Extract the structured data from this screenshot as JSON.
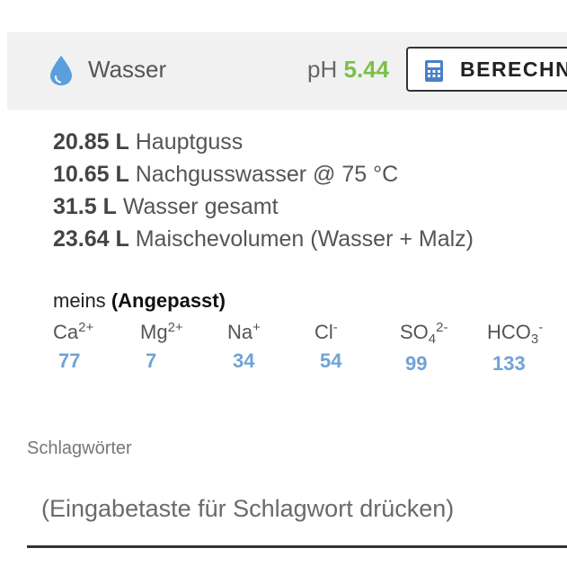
{
  "header": {
    "icon": "water-drop-icon",
    "title": "Wasser",
    "ph_label": "pH",
    "ph_value": "5.44",
    "calc_icon": "calculator-icon",
    "calc_button_label": "BERECHN"
  },
  "volumes": [
    {
      "amount": "20.85 L",
      "label": "Hauptguss"
    },
    {
      "amount": "10.65 L",
      "label": "Nachgusswasser @ 75 °C"
    },
    {
      "amount": "31.5 L",
      "label": "Wasser gesamt"
    },
    {
      "amount": "23.64 L",
      "label": "Maischevolumen (Wasser + Malz)"
    }
  ],
  "profile": {
    "name": "meins",
    "status": "(Angepasst)"
  },
  "ions": [
    {
      "base": "Ca",
      "sub": "",
      "charge": "2+",
      "value": "77"
    },
    {
      "base": "Mg",
      "sub": "",
      "charge": "2+",
      "value": "7"
    },
    {
      "base": "Na",
      "sub": "",
      "charge": "+",
      "value": "34"
    },
    {
      "base": "Cl",
      "sub": "",
      "charge": "-",
      "value": "54"
    },
    {
      "base": "SO",
      "sub": "4",
      "charge": "2-",
      "value": "99"
    },
    {
      "base": "HCO",
      "sub": "3",
      "charge": "-",
      "value": "133"
    }
  ],
  "tags": {
    "label": "Schlagwörter",
    "placeholder": "(Eingabetaste für Schlagwort drücken)",
    "value": ""
  },
  "colors": {
    "ph_value": "#7cbf49",
    "ion_value": "#6fa3d6",
    "drop_icon": "#5a9fdc",
    "header_bg": "#f1f1f1"
  }
}
